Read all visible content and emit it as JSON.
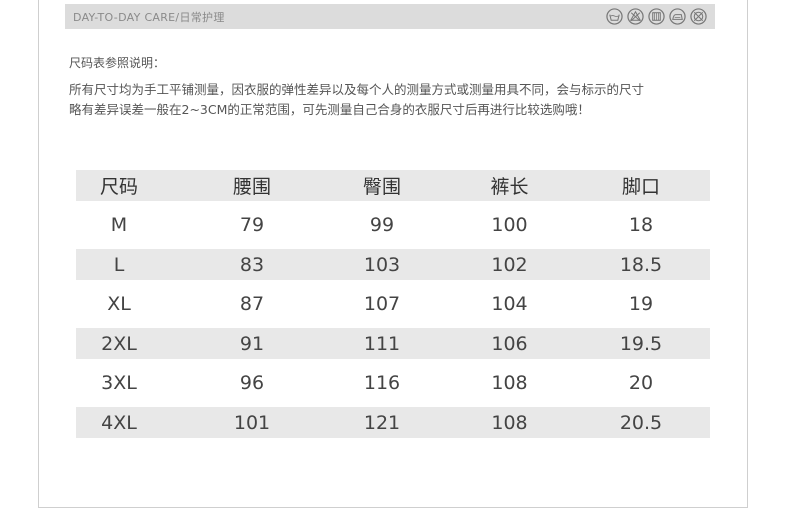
{
  "header": {
    "title": "DAY-TO-DAY CARE/日常护理",
    "care_icons": [
      "wash-tub-icon",
      "no-bleach-icon",
      "tumble-dry-icon",
      "iron-icon",
      "no-dry-clean-icon"
    ]
  },
  "note": {
    "heading": "尺码表参照说明：",
    "line1": "所有尺寸均为手工平铺测量，因衣服的弹性差异以及每个人的测量方式或测量用具不同，会与标示的尺寸",
    "line2": "略有差异误差一般在2~3CM的正常范围，可先测量自己合身的衣服尺寸后再进行比较选购哦！"
  },
  "table": {
    "headers": [
      "尺码",
      "腰围",
      "臀围",
      "裤长",
      "脚口"
    ],
    "rows": [
      [
        "M",
        "79",
        "99",
        "100",
        "18"
      ],
      [
        "L",
        "83",
        "103",
        "102",
        "18.5"
      ],
      [
        "XL",
        "87",
        "107",
        "104",
        "19"
      ],
      [
        "2XL",
        "91",
        "111",
        "106",
        "19.5"
      ],
      [
        "3XL",
        "96",
        "116",
        "108",
        "20"
      ],
      [
        "4XL",
        "101",
        "121",
        "108",
        "20.5"
      ]
    ]
  }
}
